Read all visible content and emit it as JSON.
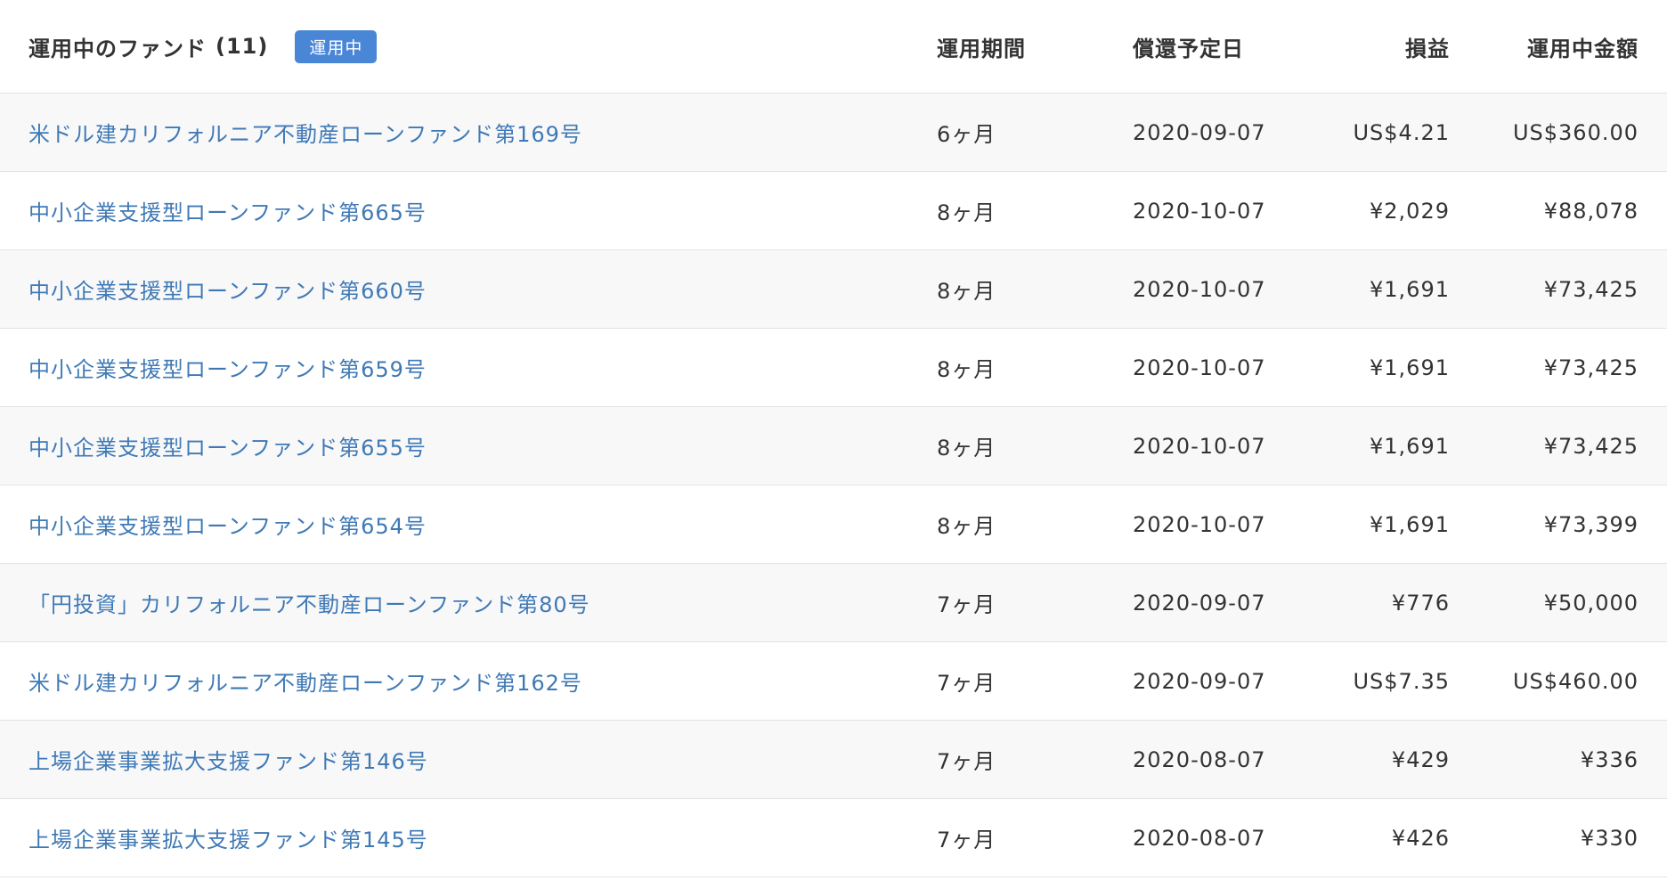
{
  "header": {
    "title": "運用中のファンド",
    "count": "(11)",
    "badge": "運用中",
    "columns": {
      "period": "運用期間",
      "redemption_date": "償還予定日",
      "profit_loss": "損益",
      "amount": "運用中金額"
    }
  },
  "rows": [
    {
      "name": "米ドル建カリフォルニア不動産ローンファンド第169号",
      "period": "6ヶ月",
      "date": "2020-09-07",
      "pl": "US$4.21",
      "amount": "US$360.00"
    },
    {
      "name": "中小企業支援型ローンファンド第665号",
      "period": "8ヶ月",
      "date": "2020-10-07",
      "pl": "¥2,029",
      "amount": "¥88,078"
    },
    {
      "name": "中小企業支援型ローンファンド第660号",
      "period": "8ヶ月",
      "date": "2020-10-07",
      "pl": "¥1,691",
      "amount": "¥73,425"
    },
    {
      "name": "中小企業支援型ローンファンド第659号",
      "period": "8ヶ月",
      "date": "2020-10-07",
      "pl": "¥1,691",
      "amount": "¥73,425"
    },
    {
      "name": "中小企業支援型ローンファンド第655号",
      "period": "8ヶ月",
      "date": "2020-10-07",
      "pl": "¥1,691",
      "amount": "¥73,425"
    },
    {
      "name": "中小企業支援型ローンファンド第654号",
      "period": "8ヶ月",
      "date": "2020-10-07",
      "pl": "¥1,691",
      "amount": "¥73,399"
    },
    {
      "name": "「円投資」カリフォルニア不動産ローンファンド第80号",
      "period": "7ヶ月",
      "date": "2020-09-07",
      "pl": "¥776",
      "amount": "¥50,000"
    },
    {
      "name": "米ドル建カリフォルニア不動産ローンファンド第162号",
      "period": "7ヶ月",
      "date": "2020-09-07",
      "pl": "US$7.35",
      "amount": "US$460.00"
    },
    {
      "name": "上場企業事業拡大支援ファンド第146号",
      "period": "7ヶ月",
      "date": "2020-08-07",
      "pl": "¥429",
      "amount": "¥336"
    },
    {
      "name": "上場企業事業拡大支援ファンド第145号",
      "period": "7ヶ月",
      "date": "2020-08-07",
      "pl": "¥426",
      "amount": "¥330"
    }
  ],
  "colors": {
    "link": "#3f79b5",
    "badge": "#4a86d6",
    "stripe": "#f8f8f9",
    "border": "#e3e3e3"
  }
}
